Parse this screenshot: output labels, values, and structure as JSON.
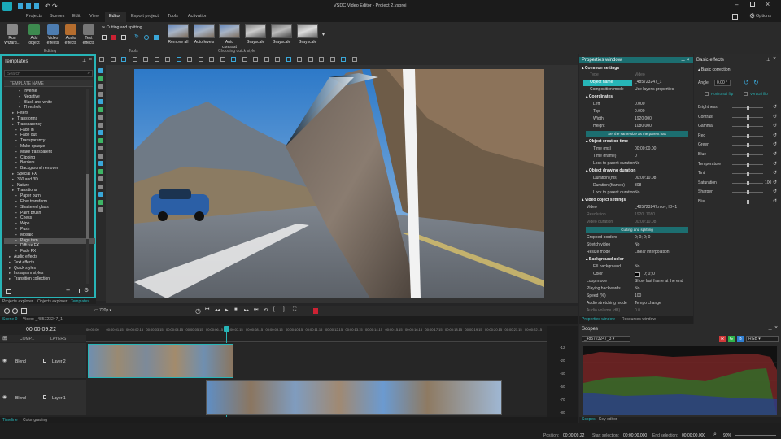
{
  "app": {
    "title": "VSDC Video Editor - Project 2.vsproj",
    "options_label": "Options"
  },
  "menu": [
    "Projects",
    "Scenes",
    "Edit",
    "View",
    "Editor",
    "Export project",
    "Tools",
    "Activation"
  ],
  "ribbon": {
    "buttons": [
      "Run Wizard...",
      "Add object",
      "Video effects",
      "Audio effects",
      "Text effects"
    ],
    "cutting": "Cutting and splitting",
    "groups": {
      "editing": "Editing",
      "tools": "Tools",
      "quick": "Choosing quick style"
    },
    "presets": [
      "Remove all",
      "Auto levels",
      "Auto contrast",
      "Grayscale",
      "Grayscale",
      "Grayscale"
    ]
  },
  "templates": {
    "title": "Templates",
    "search_placeholder": "Search",
    "header": "TEMPLATE NAME",
    "items": [
      "Inverse",
      "Negative",
      "Black and white",
      "Threshold",
      "Filters",
      "Transforms",
      "Transparency",
      "Fade in",
      "Fade out",
      "Transparency",
      "Make opaque",
      "Make transparent",
      "Clipping",
      "Borders",
      "Background remover",
      "Special FX",
      "360 and 3D",
      "Nature",
      "Transitions",
      "Paper burn",
      "Flow transform",
      "Shattered glass",
      "Paint brush",
      "Chess",
      "Wipe",
      "Push",
      "Mosaic",
      "Page turn",
      "Diffuse FX",
      "Fade FX",
      "Audio effects",
      "Text effects",
      "Quick styles",
      "Instagram styles",
      "Transition collection"
    ],
    "selected": "Page turn",
    "tabs": [
      "Projects explorer",
      "Objects explorer",
      "Templates"
    ]
  },
  "properties": {
    "title": "Properties window",
    "common": "Common settings",
    "type_k": "Type",
    "type_v": "Video",
    "objname_k": "Object name",
    "objname_v": "_485723247_1",
    "comp_k": "Composition mode",
    "comp_v": "Use layer's properties",
    "coords": "Coordinates",
    "left_k": "Left",
    "left_v": "0.000",
    "top_k": "Top",
    "top_v": "0.000",
    "width_k": "Width",
    "width_v": "1920.000",
    "height_k": "Height",
    "height_v": "1080.000",
    "same_size": "Set the same size as the parent has",
    "creation": "Object creation time",
    "time_ms_k": "Time (ms)",
    "time_ms_v": "00:00:00.00",
    "time_fr_k": "Time (frame)",
    "time_fr_v": "0",
    "lock1_k": "Lock to parent duration",
    "lock1_v": "No",
    "drawing": "Object drawing duration",
    "dur_ms_k": "Duration (ms)",
    "dur_ms_v": "00:00:10.08",
    "dur_fr_k": "Duration (frames)",
    "dur_fr_v": "308",
    "lock2_k": "Lock to parent duration",
    "lock2_v": "No",
    "vos": "Video object settings",
    "video_k": "Video",
    "video_v": "_485723247.mov; ID=1",
    "res_k": "Resolution",
    "res_v": "1920; 1080",
    "vdur_k": "Video duration",
    "vdur_v": "00:00:10.08",
    "cut_btn": "Cutting and splitting",
    "crop_k": "Cropped borders",
    "crop_v": "0; 0; 0; 0",
    "stretch_k": "Stretch video",
    "stretch_v": "No",
    "resize_k": "Resize mode",
    "resize_v": "Linear interpolation",
    "bg": "Background color",
    "fill_k": "Fill background",
    "fill_v": "No",
    "color_k": "Color",
    "color_v": "0; 0; 0",
    "loop_k": "Loop mode",
    "loop_v": "Show last frame at the end",
    "back_k": "Playing backwards",
    "back_v": "No",
    "speed_k": "Speed (%)",
    "speed_v": "100",
    "audio_k": "Audio stretching mode",
    "audio_v": "Tempo change",
    "vol_k": "Audio volume (dB)",
    "vol_v": "0.0",
    "tabs": [
      "Properties window",
      "Resources window"
    ]
  },
  "basic": {
    "title": "Basic effects",
    "correction": "Basic correction",
    "angle_k": "Angle",
    "angle_v": "0.00 °",
    "hflip": "Horizontal flip",
    "vflip": "Vertical flip",
    "rows": [
      "Brightness",
      "Contrast",
      "Gamma",
      "Red",
      "Green",
      "Blue",
      "Temperature",
      "Tint",
      "Saturation",
      "Sharpen",
      "Blur"
    ],
    "sat_v": "100"
  },
  "playbar": {
    "zoom": "720p"
  },
  "timeline": {
    "tabs": [
      "Scene 0",
      "Video: _485723247_1"
    ],
    "time": "00:00:09.22",
    "comp": "COMP...",
    "layers": "LAYERS",
    "blend1": "Blend",
    "layer1": "Layer 2",
    "blend2": "Blend",
    "layer2": "Layer 1",
    "ruler": [
      "00:00:00",
      "00:00:01.15",
      "00:00:02.15",
      "00:00:03.15",
      "00:00:04.15",
      "00:00:05.15",
      "00:00:06.15",
      "00:00:07.15",
      "00:00:08.15",
      "00:00:09.15",
      "00:00:10.15",
      "00:00:11.15",
      "00:00:12.15",
      "00:00:13.15",
      "00:00:14.15",
      "00:00:15.15",
      "00:00:16.15",
      "00:00:17.15",
      "00:00:18.15",
      "00:00:19.15",
      "00:00:20.15",
      "00:00:21.15",
      "00:00:22.15"
    ],
    "db": [
      "-12",
      "-20",
      "-40",
      "-50",
      "-70",
      "-80"
    ],
    "bottom_tabs": [
      "Timeline",
      "Color grading"
    ]
  },
  "scopes": {
    "title": "Scopes",
    "source": "_485723247_3",
    "mode": "RGB",
    "channels": [
      "R",
      "G",
      "B"
    ],
    "tabs": [
      "Scopes",
      "Key editor"
    ]
  },
  "status": {
    "position_k": "Position:",
    "position_v": "00:00:09.22",
    "start_k": "Start selection:",
    "start_v": "00:00:00.000",
    "end_k": "End selection:",
    "end_v": "00:00:00.000",
    "zoom": "90%"
  },
  "colors": {
    "accent": "#27b5b7",
    "bg": "#252526",
    "panel": "#2b2b2b"
  }
}
